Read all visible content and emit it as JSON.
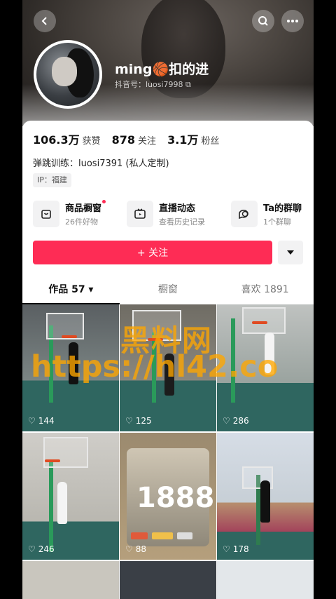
{
  "header": {
    "back_icon": "chevron-left-icon",
    "search_icon": "search-icon",
    "more_icon": "more-dots-icon"
  },
  "profile": {
    "name": "ming🏀扣的进",
    "douyin_id": "抖音号：luosi7998",
    "stats": [
      {
        "num": "106.3万",
        "label": "获赞"
      },
      {
        "num": "878",
        "label": "关注"
      },
      {
        "num": "3.1万",
        "label": "粉丝"
      }
    ],
    "bio": "弹跳训练：luosi7391 (私人定制)",
    "ip": "IP：福建"
  },
  "features": [
    {
      "title": "商品橱窗",
      "sub": "26件好物",
      "icon": "shopping-bag-icon",
      "dot": true
    },
    {
      "title": "直播动态",
      "sub": "查看历史记录",
      "icon": "tv-icon",
      "dot": false
    },
    {
      "title": "Ta的群聊",
      "sub": "1个群聊",
      "icon": "chat-bubble-icon",
      "dot": false
    }
  ],
  "actions": {
    "follow_label": "+ 关注",
    "dropdown_icon": "triangle-down-icon"
  },
  "tabs": [
    {
      "label": "作品 57 ▾",
      "active": true
    },
    {
      "label": "橱窗",
      "active": false
    },
    {
      "label": "喜欢 1891",
      "active": false
    }
  ],
  "videos": [
    {
      "likes": "144"
    },
    {
      "likes": "125"
    },
    {
      "likes": "286"
    },
    {
      "likes": "246"
    },
    {
      "likes": "88"
    },
    {
      "likes": "178"
    }
  ],
  "card_text": "1888",
  "watermark": {
    "line1": "黑料网",
    "line2": "https://hl42.co"
  },
  "colors": {
    "accent": "#fe2c55",
    "watermark": "#ffa600"
  }
}
